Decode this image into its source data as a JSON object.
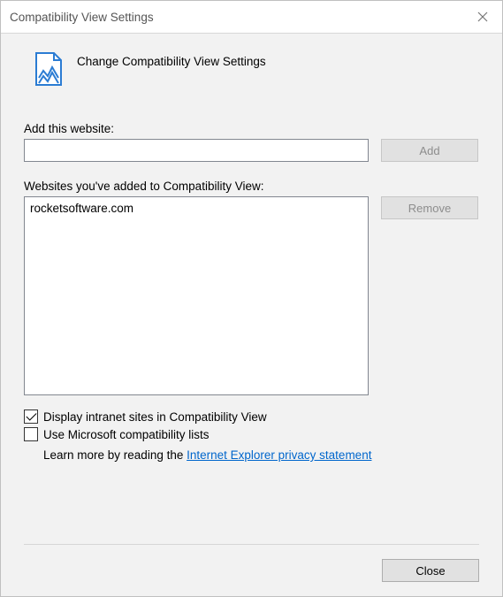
{
  "window": {
    "title": "Compatibility View Settings"
  },
  "header": {
    "caption": "Change Compatibility View Settings",
    "icon": "page-compat-icon"
  },
  "add_section": {
    "label": "Add this website:",
    "input_value": "",
    "add_button": "Add"
  },
  "list_section": {
    "label": "Websites you've added to Compatibility View:",
    "items": [
      "rocketsoftware.com"
    ],
    "remove_button": "Remove"
  },
  "checkboxes": {
    "intranet": {
      "label": "Display intranet sites in Compatibility View",
      "checked": true
    },
    "mslists": {
      "label": "Use Microsoft compatibility lists",
      "checked": false
    }
  },
  "learn_more": {
    "prefix": "Learn more by reading the ",
    "link_text": "Internet Explorer privacy statement"
  },
  "footer": {
    "close_button": "Close"
  }
}
